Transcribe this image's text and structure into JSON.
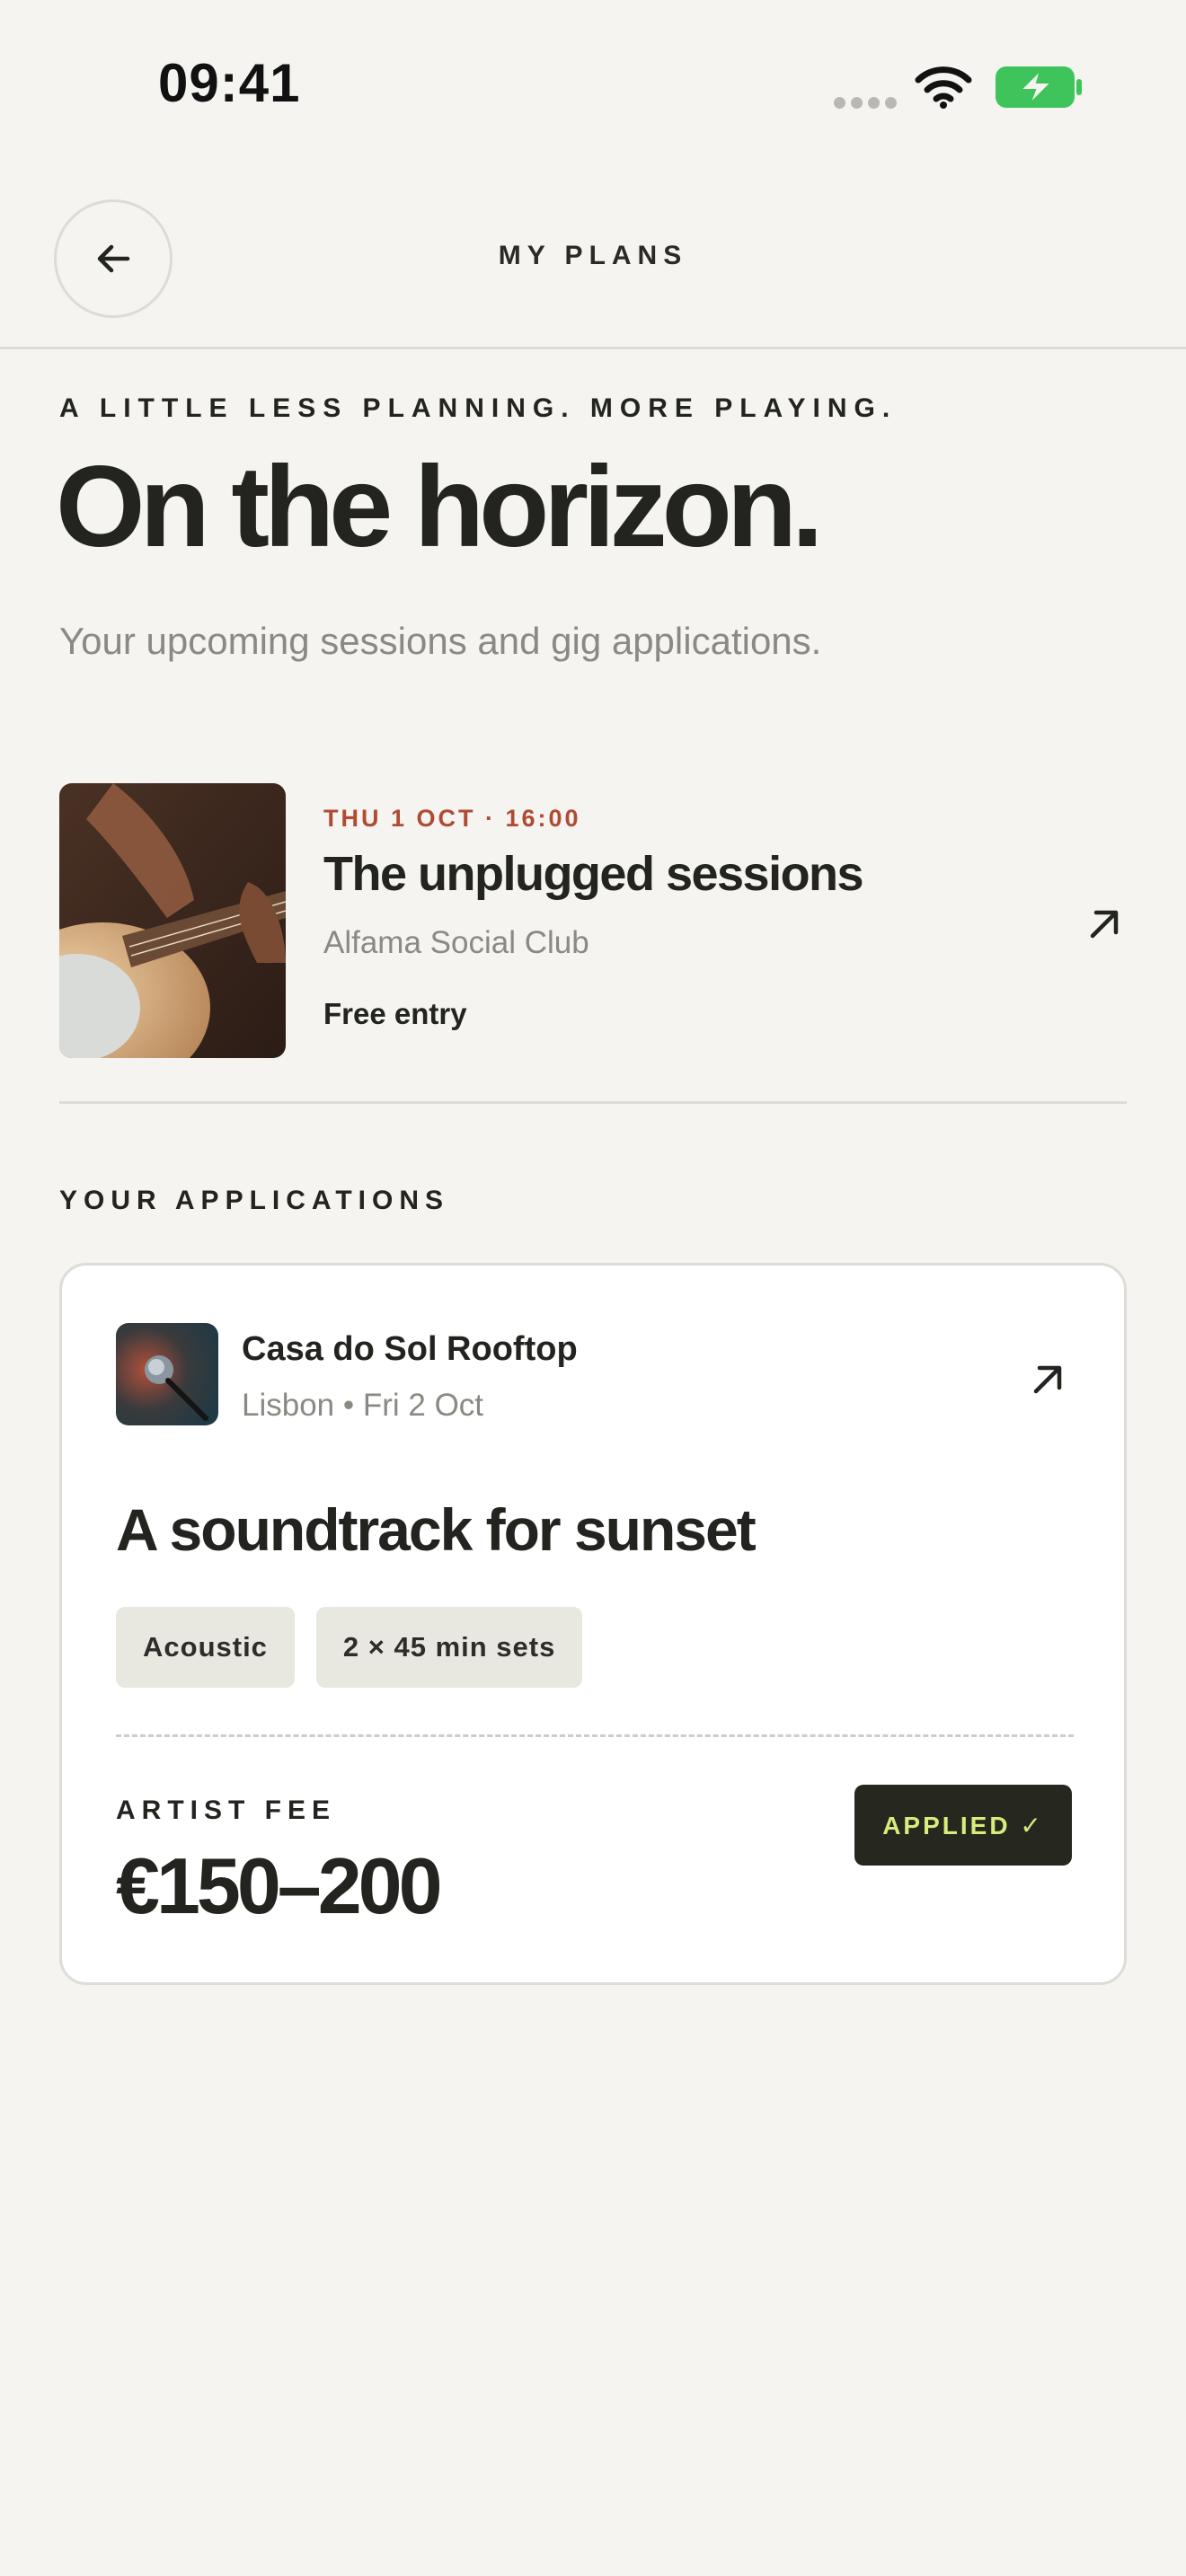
{
  "status_bar": {
    "time": "09:41"
  },
  "header": {
    "title": "MY PLANS",
    "back_icon": "arrow-left-icon"
  },
  "hero": {
    "eyebrow": "A LITTLE LESS PLANNING. MORE PLAYING.",
    "title": "On the horizon.",
    "subtitle": "Your upcoming sessions and gig applications."
  },
  "upcoming": {
    "datetime": "THU 1 OCT · 16:00",
    "title": "The unplugged sessions",
    "venue": "Alfama Social Club",
    "price": "Free entry",
    "image": "guitar-photo",
    "arrow_icon": "arrow-up-right-icon"
  },
  "applications": {
    "heading": "YOUR APPLICATIONS",
    "items": [
      {
        "venue": "Casa do Sol Rooftop",
        "meta": "Lisbon • Fri 2 Oct",
        "image": "microphone-photo",
        "title": "A soundtrack for sunset",
        "tags": [
          "Acoustic",
          "2 × 45 min sets"
        ],
        "fee_label": "ARTIST FEE",
        "fee_value": "€150–200",
        "status": "APPLIED ✓",
        "arrow_icon": "arrow-up-right-icon"
      }
    ]
  },
  "colors": {
    "background": "#f5f4f0",
    "accent_date": "#b04a32",
    "badge_bg": "#26271f",
    "badge_text": "#d6ec7c",
    "battery": "#3ec45a"
  }
}
